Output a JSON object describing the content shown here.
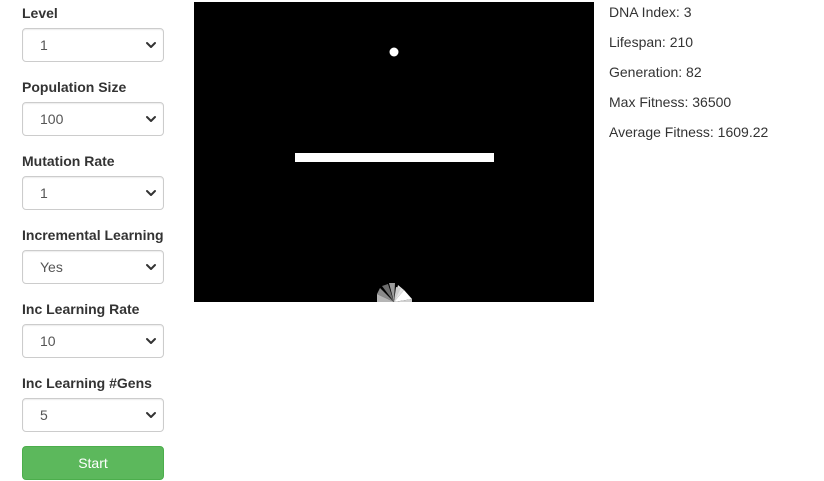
{
  "controls": {
    "level": {
      "label": "Level",
      "value": "1"
    },
    "population_size": {
      "label": "Population Size",
      "value": "100"
    },
    "mutation_rate": {
      "label": "Mutation Rate",
      "value": "1"
    },
    "incremental_learning": {
      "label": "Incremental Learning",
      "value": "Yes"
    },
    "inc_learning_rate": {
      "label": "Inc Learning Rate",
      "value": "10"
    },
    "inc_learning_gens": {
      "label": "Inc Learning #Gens",
      "value": "5"
    },
    "start_label": "Start"
  },
  "stats": {
    "dna_index": "DNA Index: 3",
    "lifespan": "Lifespan: 210",
    "generation": "Generation: 82",
    "max_fitness": "Max Fitness: 36500",
    "average_fitness": "Average Fitness: 1609.22"
  },
  "colors": {
    "canvas_background": "#000000",
    "start_button": "#5cb85c",
    "shapes": "#ffffff"
  },
  "icons": {
    "select_arrow": "chevron-down-icon"
  }
}
